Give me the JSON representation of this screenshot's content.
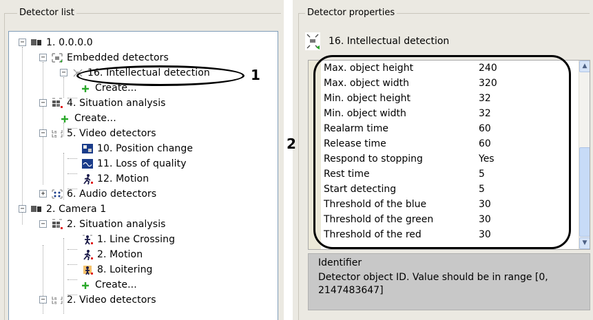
{
  "left_panel": {
    "title": "Detector list",
    "tree": [
      {
        "label": "1. 0.0.0.0",
        "expander": "−",
        "icon": "camera-server-icon"
      },
      {
        "label": "Embedded detectors",
        "expander": "−",
        "icon": "embedded-detectors-icon"
      },
      {
        "label": "16. Intellectual detection",
        "expander": "−",
        "icon": "intellectual-detection-icon"
      },
      {
        "label": "Create...",
        "icon": "add-icon"
      },
      {
        "label": "4. Situation analysis",
        "expander": "−",
        "icon": "situation-analysis-icon"
      },
      {
        "label": "Create...",
        "icon": "add-icon"
      },
      {
        "label": "5. Video detectors",
        "expander": "−",
        "icon": "video-detectors-icon"
      },
      {
        "label": "10. Position change",
        "icon": "position-change-icon"
      },
      {
        "label": "11. Loss of quality",
        "icon": "loss-of-quality-icon"
      },
      {
        "label": "12. Motion",
        "icon": "motion-icon"
      },
      {
        "label": "6. Audio detectors",
        "expander": "+",
        "icon": "audio-detectors-icon"
      },
      {
        "label": "2. Camera 1",
        "expander": "−",
        "icon": "camera-icon"
      },
      {
        "label": "2. Situation analysis",
        "expander": "−",
        "icon": "situation-analysis-icon"
      },
      {
        "label": "1. Line Crossing",
        "icon": "line-crossing-icon"
      },
      {
        "label": "2. Motion",
        "icon": "motion-icon"
      },
      {
        "label": "8. Loitering",
        "icon": "loitering-icon"
      },
      {
        "label": "Create...",
        "icon": "add-icon"
      },
      {
        "label": "2. Video detectors",
        "expander": "−",
        "icon": "video-detectors-icon"
      }
    ]
  },
  "callouts": {
    "one": "1",
    "two": "2"
  },
  "right_panel": {
    "title": "Detector properties",
    "header_label": "16. Intellectual detection",
    "properties": [
      {
        "name": "Max. object height",
        "value": "240"
      },
      {
        "name": "Max. object width",
        "value": "320"
      },
      {
        "name": "Min. object height",
        "value": "32"
      },
      {
        "name": "Min. object width",
        "value": "32"
      },
      {
        "name": "Realarm time",
        "value": "60"
      },
      {
        "name": "Release time",
        "value": "60"
      },
      {
        "name": "Respond to stopping",
        "value": "Yes"
      },
      {
        "name": "Rest time",
        "value": "5"
      },
      {
        "name": "Start detecting",
        "value": "5"
      },
      {
        "name": "Threshold of the blue",
        "value": "30"
      },
      {
        "name": "Threshold of the green",
        "value": "30"
      },
      {
        "name": "Threshold of the red",
        "value": "30"
      }
    ],
    "description": {
      "title": "Identifier",
      "text": "Detector object ID. Value should be in range [0, 2147483647]"
    }
  },
  "colors": {
    "panel_bg": "#ebe9e2",
    "tree_border": "#7f9db9",
    "desc_bg": "#c8c8c8",
    "add_icon": "#2aa82a"
  }
}
